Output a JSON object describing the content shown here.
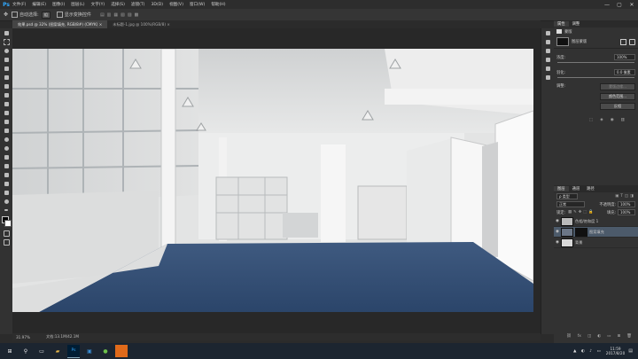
{
  "app": {
    "logo": "Ps"
  },
  "menu": [
    "文件(F)",
    "编辑(E)",
    "图像(I)",
    "图层(L)",
    "文字(Y)",
    "选择(S)",
    "滤镜(T)",
    "3D(D)",
    "视图(V)",
    "窗口(W)",
    "帮助(H)"
  ],
  "window_controls": [
    "—",
    "▢",
    "✕"
  ],
  "options": {
    "auto_select_label": "自动选择:",
    "auto_select_value": "组",
    "transform_label": "显示变换控件"
  },
  "tabs": [
    {
      "label": "效果.psd @ 32% (图案填充, RGB/8#) (CMYK) ×"
    },
    {
      "label": "未标题-1.jpg @ 100%(RGB/8) ×"
    }
  ],
  "status": {
    "zoom": "31.97%",
    "doc": "文档:13.1M/42.1M"
  },
  "properties_panel": {
    "tabs": [
      "属性",
      "调整"
    ],
    "type_label": "蒙版",
    "mask_label": "图层蒙版",
    "density_label": "浓度:",
    "density_value": "100%",
    "feather_label": "羽化:",
    "feather_value": "0.0 像素",
    "adjust_label": "调整:",
    "btn_edge": "蒙版边缘...",
    "btn_color": "颜色范围...",
    "btn_invert": "反相"
  },
  "layers_panel": {
    "tabs": [
      "图层",
      "通道",
      "路径"
    ],
    "kind_label": "ρ 类型",
    "mode_value": "正常",
    "opacity_label": "不透明度:",
    "opacity_value": "100%",
    "lock_label": "锁定:",
    "fill_label": "填充:",
    "fill_value": "100%",
    "layers": [
      {
        "name": "色相/饱和度 1",
        "selected": false
      },
      {
        "name": "图案填充",
        "selected": true
      },
      {
        "name": "背景",
        "selected": false
      }
    ]
  },
  "taskbar": {
    "time": "11:59",
    "date": "2017/8/20",
    "icons": [
      "windows-icon",
      "search-icon",
      "task-view-icon",
      "explorer-icon",
      "photoshop-icon",
      "store-icon",
      "browser-icon",
      "app-icon"
    ]
  },
  "colors": {
    "accent": "#31a8ff",
    "floor": "#2f4a72",
    "selection": "#4c5a6a"
  }
}
